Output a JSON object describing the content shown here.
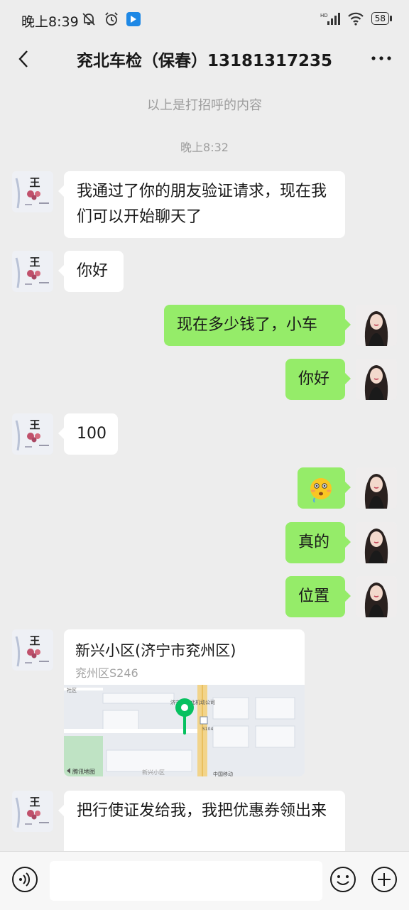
{
  "status_bar": {
    "time": "晚上8:39",
    "network": "HD",
    "battery": "58"
  },
  "header": {
    "title": "兖北车检（保春）13181317235"
  },
  "system": {
    "greeting_note": "以上是打招呼的内容",
    "timestamp": "晚上8:32"
  },
  "messages": [
    {
      "side": "left",
      "text": "我通过了你的朋友验证请求，现在我们可以开始聊天了"
    },
    {
      "side": "left",
      "text": "你好"
    },
    {
      "side": "right",
      "text": "现在多少钱了，小车"
    },
    {
      "side": "right",
      "text": "你好"
    },
    {
      "side": "left",
      "text": "100"
    },
    {
      "side": "right",
      "type": "emoji",
      "emoji": "flushed-emoji"
    },
    {
      "side": "right",
      "text": "真的"
    },
    {
      "side": "right",
      "text": "位置"
    },
    {
      "side": "left",
      "type": "location",
      "name": "新兴小区(济宁市兖州区)",
      "address": "兖州区S246",
      "map_labels": {
        "provider": "腾讯地图",
        "poi_1": "济宁",
        "poi_2": "北机动公司",
        "road": "S104",
        "area": "新兴小区",
        "mobile": "中国移动"
      }
    },
    {
      "side": "left",
      "text": "把行使证发给我，我把优惠券领出来"
    }
  ],
  "input_bar": {
    "placeholder": ""
  },
  "colors": {
    "background": "#ededed",
    "sent_bubble": "#95ec69",
    "received_bubble": "#ffffff",
    "pin": "#07c160"
  }
}
